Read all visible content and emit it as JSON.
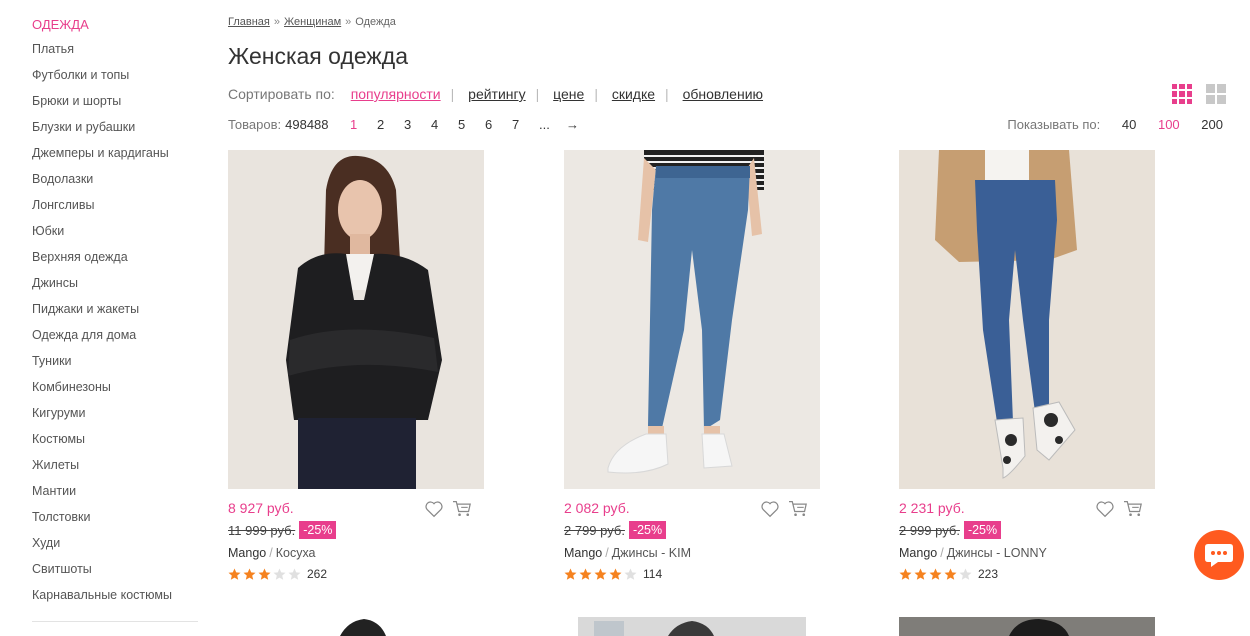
{
  "sidebar": {
    "heading": "ОДЕЖДА",
    "items": [
      {
        "label": "Платья"
      },
      {
        "label": "Футболки и топы"
      },
      {
        "label": "Брюки и шорты"
      },
      {
        "label": "Блузки и рубашки"
      },
      {
        "label": "Джемперы и кардиганы"
      },
      {
        "label": "Водолазки"
      },
      {
        "label": "Лонгсливы"
      },
      {
        "label": "Юбки"
      },
      {
        "label": "Верхняя одежда"
      },
      {
        "label": "Джинсы"
      },
      {
        "label": "Пиджаки и жакеты"
      },
      {
        "label": "Одежда для дома"
      },
      {
        "label": "Туники"
      },
      {
        "label": "Комбинезоны"
      },
      {
        "label": "Кигуруми"
      },
      {
        "label": "Костюмы"
      },
      {
        "label": "Жилеты"
      },
      {
        "label": "Мантии"
      },
      {
        "label": "Толстовки"
      },
      {
        "label": "Худи"
      },
      {
        "label": "Свитшоты"
      },
      {
        "label": "Карнавальные костюмы"
      }
    ]
  },
  "breadcrumb": {
    "items": [
      "Главная",
      "Женщинам",
      "Одежда"
    ],
    "separator": "»"
  },
  "page_title": "Женская одежда",
  "sort": {
    "label": "Сортировать по:",
    "options": [
      "популярности",
      "рейтингу",
      "цене",
      "скидке",
      "обновлению"
    ],
    "active": "популярности",
    "divider": "|"
  },
  "count": {
    "label": "Товаров:",
    "value": "498488"
  },
  "pagination": {
    "pages": [
      "1",
      "2",
      "3",
      "4",
      "5",
      "6",
      "7",
      "...",
      "→"
    ],
    "current": "1"
  },
  "per_page": {
    "label": "Показывать по:",
    "options": [
      "40",
      "100",
      "200"
    ],
    "active": "100"
  },
  "colors": {
    "accent": "#e83e8c",
    "star_filled": "#f5821f",
    "star_empty": "#e0e0e0",
    "chat": "#ff5a1f"
  },
  "products": [
    {
      "price": "8 927 руб.",
      "old_price": "11 999 руб.",
      "discount": "-25%",
      "brand": "Mango",
      "name": "Косуха",
      "rating": 3,
      "reviews": "262",
      "image": "woman-leather-jacket-photo"
    },
    {
      "price": "2 082 руб.",
      "old_price": "2 799 руб.",
      "discount": "-25%",
      "brand": "Mango",
      "name": "Джинсы - KIM",
      "rating": 4,
      "reviews": "114",
      "image": "skinny-jeans-photo"
    },
    {
      "price": "2 231 руб.",
      "old_price": "2 999 руб.",
      "discount": "-25%",
      "brand": "Mango",
      "name": "Джинсы - LONNY",
      "rating": 4,
      "reviews": "223",
      "image": "jeans-beige-blazer-photo"
    }
  ],
  "brand_separator": "/",
  "icons": {
    "favorite": "heart-icon",
    "cart": "cart-icon",
    "chat": "chat-icon",
    "grid_dense": "grid-3x3-icon",
    "grid_large": "grid-2x2-icon"
  }
}
